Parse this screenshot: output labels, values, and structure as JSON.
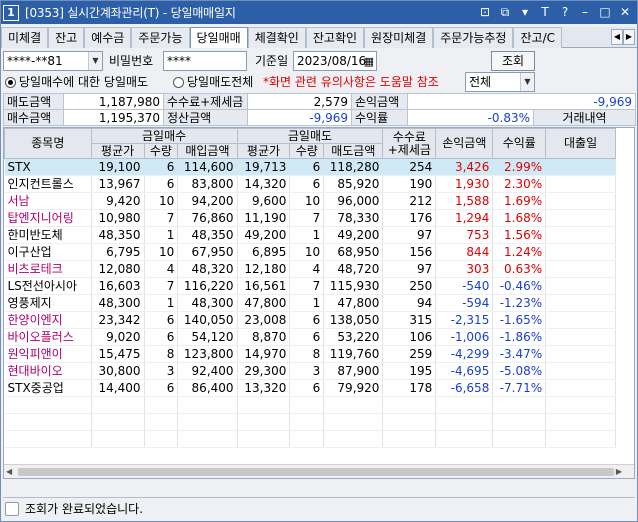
{
  "window": {
    "number": "1",
    "title": "[0353] 실시간계좌관리(T) - 당일매매일지",
    "controls": [
      "⊡",
      "⧉",
      "▾",
      "T",
      "?",
      "–",
      "□",
      "✕"
    ]
  },
  "tabs": [
    {
      "label": "미체결"
    },
    {
      "label": "잔고"
    },
    {
      "label": "예수금"
    },
    {
      "label": "주문가능"
    },
    {
      "label": "당일매매"
    },
    {
      "label": "체결확인"
    },
    {
      "label": "잔고확인"
    },
    {
      "label": "원장미체결"
    },
    {
      "label": "주문가능추정"
    },
    {
      "label": "잔고/C"
    }
  ],
  "tab_nav": [
    "◀",
    "▶"
  ],
  "form": {
    "account": "****-**81",
    "password_label": "비밀번호",
    "password": "****",
    "date_label": "기준일",
    "date": "2023/08/16",
    "query_button": "조회",
    "radio1": "당일매수에 대한 당일매도",
    "radio2": "당일매도전체",
    "notice": "*화면 관련 유의사항은 도움말 참조",
    "filter": "전체"
  },
  "summary": {
    "sell_amount_label": "매도금액",
    "sell_amount": "1,187,980",
    "fee_tax_label": "수수료+제세금",
    "fee_tax": "2,579",
    "pnl_amount_label": "손익금액",
    "pnl_amount": "-9,969",
    "buy_amount_label": "매수금액",
    "buy_amount": "1,195,370",
    "settle_amount_label": "정산금액",
    "settle_amount": "-9,969",
    "return_rate_label": "수익률",
    "return_rate": "-0.83%",
    "trade_history_label": "거래내역"
  },
  "columns": {
    "name": "종목명",
    "buy_group": "금일매수",
    "sell_group": "금일매도",
    "fee": "수수료\n+제세금",
    "pnl": "손익금액",
    "rate": "수익률",
    "loan_date": "대출일",
    "buy_avg": "평균가",
    "buy_qty": "수량",
    "buy_amount": "매입금액",
    "sell_avg": "평균가",
    "sell_qty": "수량",
    "sell_amount": "매도금액"
  },
  "rows": [
    {
      "name": "STX",
      "name_color": "#000000",
      "buy_avg": "19,100",
      "buy_qty": "6",
      "buy_amount": "114,600",
      "sell_avg": "19,713",
      "sell_qty": "6",
      "sell_amount": "118,280",
      "fee": "254",
      "pnl": "3,426",
      "rate": "2.99%",
      "sign": "pos"
    },
    {
      "name": "인지컨트롤스",
      "name_color": "#000000",
      "buy_avg": "13,967",
      "buy_qty": "6",
      "buy_amount": "83,800",
      "sell_avg": "14,320",
      "sell_qty": "6",
      "sell_amount": "85,920",
      "fee": "190",
      "pnl": "1,930",
      "rate": "2.30%",
      "sign": "pos"
    },
    {
      "name": "서남",
      "name_color": "#b0006a",
      "buy_avg": "9,420",
      "buy_qty": "10",
      "buy_amount": "94,200",
      "sell_avg": "9,600",
      "sell_qty": "10",
      "sell_amount": "96,000",
      "fee": "212",
      "pnl": "1,588",
      "rate": "1.69%",
      "sign": "pos"
    },
    {
      "name": "탑엔지니어링",
      "name_color": "#b0006a",
      "buy_avg": "10,980",
      "buy_qty": "7",
      "buy_amount": "76,860",
      "sell_avg": "11,190",
      "sell_qty": "7",
      "sell_amount": "78,330",
      "fee": "176",
      "pnl": "1,294",
      "rate": "1.68%",
      "sign": "pos"
    },
    {
      "name": "한미반도체",
      "name_color": "#000000",
      "buy_avg": "48,350",
      "buy_qty": "1",
      "buy_amount": "48,350",
      "sell_avg": "49,200",
      "sell_qty": "1",
      "sell_amount": "49,200",
      "fee": "97",
      "pnl": "753",
      "rate": "1.56%",
      "sign": "pos"
    },
    {
      "name": "이구산업",
      "name_color": "#000000",
      "buy_avg": "6,795",
      "buy_qty": "10",
      "buy_amount": "67,950",
      "sell_avg": "6,895",
      "sell_qty": "10",
      "sell_amount": "68,950",
      "fee": "156",
      "pnl": "844",
      "rate": "1.24%",
      "sign": "pos"
    },
    {
      "name": "비츠로테크",
      "name_color": "#b0006a",
      "buy_avg": "12,080",
      "buy_qty": "4",
      "buy_amount": "48,320",
      "sell_avg": "12,180",
      "sell_qty": "4",
      "sell_amount": "48,720",
      "fee": "97",
      "pnl": "303",
      "rate": "0.63%",
      "sign": "pos"
    },
    {
      "name": "LS전선아시아",
      "name_color": "#000000",
      "buy_avg": "16,603",
      "buy_qty": "7",
      "buy_amount": "116,220",
      "sell_avg": "16,561",
      "sell_qty": "7",
      "sell_amount": "115,930",
      "fee": "250",
      "pnl": "-540",
      "rate": "-0.46%",
      "sign": "neg"
    },
    {
      "name": "영풍제지",
      "name_color": "#000000",
      "buy_avg": "48,300",
      "buy_qty": "1",
      "buy_amount": "48,300",
      "sell_avg": "47,800",
      "sell_qty": "1",
      "sell_amount": "47,800",
      "fee": "94",
      "pnl": "-594",
      "rate": "-1.23%",
      "sign": "neg"
    },
    {
      "name": "한양이엔지",
      "name_color": "#b0006a",
      "buy_avg": "23,342",
      "buy_qty": "6",
      "buy_amount": "140,050",
      "sell_avg": "23,008",
      "sell_qty": "6",
      "sell_amount": "138,050",
      "fee": "315",
      "pnl": "-2,315",
      "rate": "-1.65%",
      "sign": "neg"
    },
    {
      "name": "바이오플러스",
      "name_color": "#b0006a",
      "buy_avg": "9,020",
      "buy_qty": "6",
      "buy_amount": "54,120",
      "sell_avg": "8,870",
      "sell_qty": "6",
      "sell_amount": "53,220",
      "fee": "106",
      "pnl": "-1,006",
      "rate": "-1.86%",
      "sign": "neg"
    },
    {
      "name": "원익피앤이",
      "name_color": "#b0006a",
      "buy_avg": "15,475",
      "buy_qty": "8",
      "buy_amount": "123,800",
      "sell_avg": "14,970",
      "sell_qty": "8",
      "sell_amount": "119,760",
      "fee": "259",
      "pnl": "-4,299",
      "rate": "-3.47%",
      "sign": "neg"
    },
    {
      "name": "현대바이오",
      "name_color": "#b0006a",
      "buy_avg": "30,800",
      "buy_qty": "3",
      "buy_amount": "92,400",
      "sell_avg": "29,300",
      "sell_qty": "3",
      "sell_amount": "87,900",
      "fee": "195",
      "pnl": "-4,695",
      "rate": "-5.08%",
      "sign": "neg"
    },
    {
      "name": "STX중공업",
      "name_color": "#000000",
      "buy_avg": "14,400",
      "buy_qty": "6",
      "buy_amount": "86,400",
      "sell_avg": "13,320",
      "sell_qty": "6",
      "sell_amount": "79,920",
      "fee": "178",
      "pnl": "-6,658",
      "rate": "-7.71%",
      "sign": "neg"
    }
  ],
  "status": {
    "message": "조회가 완료되었습니다."
  },
  "colors": {
    "positive": "#e00000",
    "negative": "#1b3fd1",
    "selected_row": "#cfe9f6",
    "title_bar": "#2d5fa8"
  }
}
